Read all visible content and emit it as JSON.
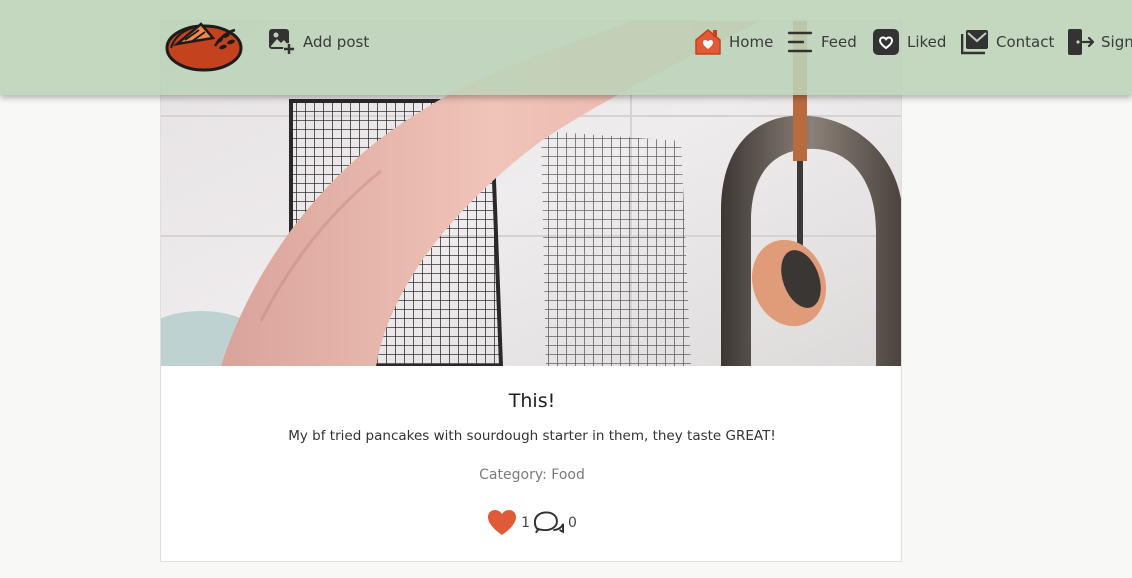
{
  "nav": {
    "add_post": "Add post",
    "home": "Home",
    "feed": "Feed",
    "liked": "Liked",
    "contact": "Contact",
    "sign": "Sign"
  },
  "post": {
    "title": "This!",
    "text": "My bf tried pancakes with sourdough starter in them, they taste GREAT!",
    "category_label": "Category: ",
    "category": "Food",
    "likes": "1",
    "comments": "0"
  },
  "colors": {
    "nav_bg": "#bcd3b8",
    "accent": "#e25a35",
    "heart": "#e25a35",
    "logo_fill": "#c4421e"
  },
  "icons": {
    "logo": "bread-loaf-logo",
    "add_post": "add-image-icon",
    "home": "home-heart-icon",
    "feed": "menu-lines-icon",
    "liked": "heart-square-icon",
    "contact": "envelope-icon",
    "sign": "door-exit-icon",
    "like": "heart-icon",
    "comment": "comment-bubbles-icon"
  }
}
